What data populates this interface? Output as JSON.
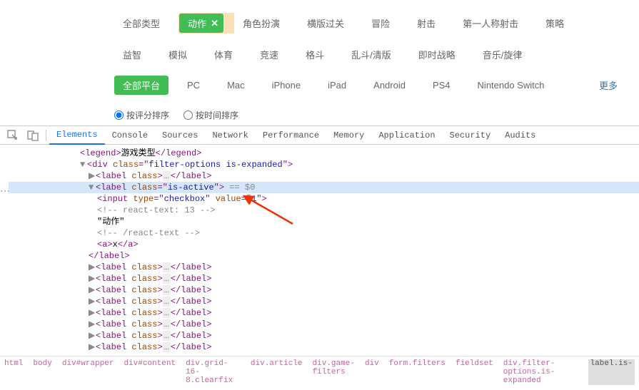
{
  "filters": {
    "row1": {
      "items": [
        {
          "label": "全部类型",
          "active": false
        },
        {
          "label": "动作",
          "active": true,
          "closeable": true,
          "highlighted": true
        },
        {
          "label": "角色扮演",
          "active": false
        },
        {
          "label": "横版过关",
          "active": false
        },
        {
          "label": "冒险",
          "active": false
        },
        {
          "label": "射击",
          "active": false
        },
        {
          "label": "第一人称射击",
          "active": false
        },
        {
          "label": "策略",
          "active": false
        }
      ]
    },
    "row2": {
      "items": [
        {
          "label": "益智"
        },
        {
          "label": "模拟"
        },
        {
          "label": "体育"
        },
        {
          "label": "竞速"
        },
        {
          "label": "格斗"
        },
        {
          "label": "乱斗/清版"
        },
        {
          "label": "即时战略"
        },
        {
          "label": "音乐/旋律"
        }
      ]
    },
    "row3": {
      "items": [
        {
          "label": "全部平台",
          "active": true
        },
        {
          "label": "PC"
        },
        {
          "label": "Mac"
        },
        {
          "label": "iPhone"
        },
        {
          "label": "iPad"
        },
        {
          "label": "Android"
        },
        {
          "label": "PS4"
        },
        {
          "label": "Nintendo Switch"
        }
      ],
      "more": "更多"
    },
    "sort": {
      "option1": "按评分排序",
      "option2": "按时间排序"
    }
  },
  "devtools": {
    "tabs": [
      "Elements",
      "Console",
      "Sources",
      "Network",
      "Performance",
      "Memory",
      "Application",
      "Security",
      "Audits"
    ],
    "active_tab": "Elements",
    "dom": {
      "legend_open": "<legend>",
      "legend_text": "游戏类型",
      "legend_close": "</legend>",
      "div_open": "<div class=\"filter-options is-expanded\">",
      "label_generic": "<label class>…</label>",
      "label_active_open": "<label class=\"is-active\">",
      "sel_suffix": " == $0",
      "input_line": "<input type=\"checkbox\" value=\"1\">",
      "react_open": "<!-- react-text: 13 -->",
      "text_value": "\"动作\"",
      "react_close": "<!-- /react-text -->",
      "a_line": "<a>x</a>",
      "label_close": "</label>"
    },
    "breadcrumb": [
      "html",
      "body",
      "div#wrapper",
      "div#content",
      "div.grid-16-8.clearfix",
      "div.article",
      "div.game-filters",
      "div",
      "form.filters",
      "fieldset",
      "div.filter-options.is-expanded",
      "label.is-"
    ]
  }
}
